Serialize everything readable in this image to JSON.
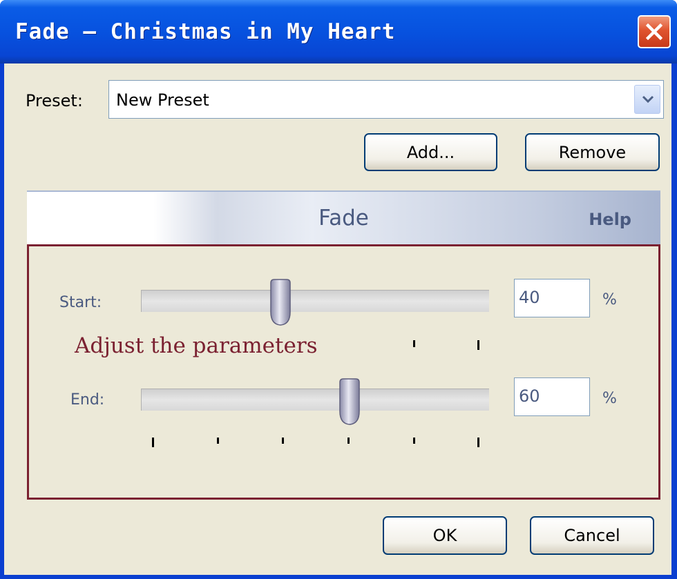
{
  "window": {
    "title": "Fade – Christmas in My Heart"
  },
  "preset": {
    "label": "Preset:",
    "value": "New Preset",
    "add_label": "Add...",
    "remove_label": "Remove"
  },
  "panel": {
    "title": "Fade",
    "help_label": "Help"
  },
  "params": {
    "start": {
      "label": "Start:",
      "value": "40",
      "unit": "%",
      "fraction": 0.4
    },
    "end": {
      "label": "End:",
      "value": "60",
      "unit": "%",
      "fraction": 0.6
    },
    "annotation": "Adjust the parameters"
  },
  "footer": {
    "ok_label": "OK",
    "cancel_label": "Cancel"
  },
  "colors": {
    "titlebar": "#0752df",
    "client_bg": "#ece9d8",
    "annotation": "#7b2131",
    "label_text": "#4a5a80"
  },
  "icons": {
    "close": "close-x-icon",
    "dropdown": "chevron-down-icon"
  }
}
